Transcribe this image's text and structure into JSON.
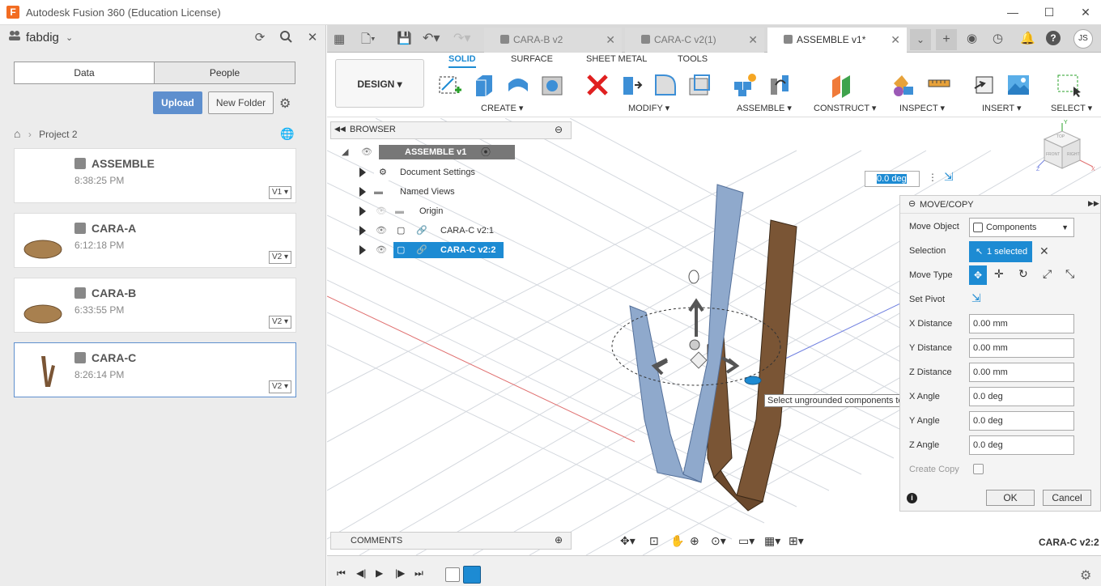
{
  "window": {
    "title": "Autodesk Fusion 360 (Education License)",
    "logo": "F"
  },
  "datapanel": {
    "hub": "fabdig",
    "tabs": [
      "Data",
      "People"
    ],
    "upload": "Upload",
    "new_folder": "New Folder",
    "project": "Project 2",
    "files": [
      {
        "name": "ASSEMBLE",
        "time": "8:38:25 PM",
        "version": "V1"
      },
      {
        "name": "CARA-A",
        "time": "6:12:18 PM",
        "version": "V2"
      },
      {
        "name": "CARA-B",
        "time": "6:33:55 PM",
        "version": "V2"
      },
      {
        "name": "CARA-C",
        "time": "8:26:14 PM",
        "version": "V2"
      }
    ]
  },
  "doctabs": [
    {
      "label": "CARA-B v2"
    },
    {
      "label": "CARA-C v2(1)"
    },
    {
      "label": "ASSEMBLE v1*"
    }
  ],
  "user_initials": "JS",
  "ribbon": {
    "design": "DESIGN",
    "tabs": [
      "SOLID",
      "SURFACE",
      "SHEET METAL",
      "TOOLS"
    ],
    "groups": [
      "CREATE",
      "MODIFY",
      "ASSEMBLE",
      "CONSTRUCT",
      "INSPECT",
      "INSERT",
      "SELECT"
    ]
  },
  "browser": {
    "title": "BROWSER",
    "root": "ASSEMBLE v1",
    "items": [
      "Document Settings",
      "Named Views",
      "Origin",
      "CARA-C v2:1",
      "CARA-C v2:2"
    ]
  },
  "angle_input": "0.0 deg",
  "tooltip": "Select ungrounded components to move",
  "movecopy": {
    "title": "MOVE/COPY",
    "move_object_label": "Move Object",
    "move_object_value": "Components",
    "selection_label": "Selection",
    "selection_value": "1 selected",
    "move_type_label": "Move Type",
    "set_pivot_label": "Set Pivot",
    "fields": [
      {
        "label": "X Distance",
        "value": "0.00 mm"
      },
      {
        "label": "Y Distance",
        "value": "0.00 mm"
      },
      {
        "label": "Z Distance",
        "value": "0.00 mm"
      },
      {
        "label": "X Angle",
        "value": "0.0 deg"
      },
      {
        "label": "Y Angle",
        "value": "0.0 deg"
      },
      {
        "label": "Z Angle",
        "value": "0.0 deg"
      }
    ],
    "create_copy_label": "Create Copy",
    "ok": "OK",
    "cancel": "Cancel"
  },
  "comments": "COMMENTS",
  "status_component": "CARA-C v2:2",
  "viewcube": {
    "top": "TOP",
    "front": "FRONT",
    "right": "RIGHT",
    "y": "Y",
    "z": "Z",
    "x": "X"
  },
  "colors": {
    "accent": "#1d8bd3",
    "upload": "#5e8fce",
    "wood": "#7a5535",
    "selected_part": "#8fa9cc"
  }
}
